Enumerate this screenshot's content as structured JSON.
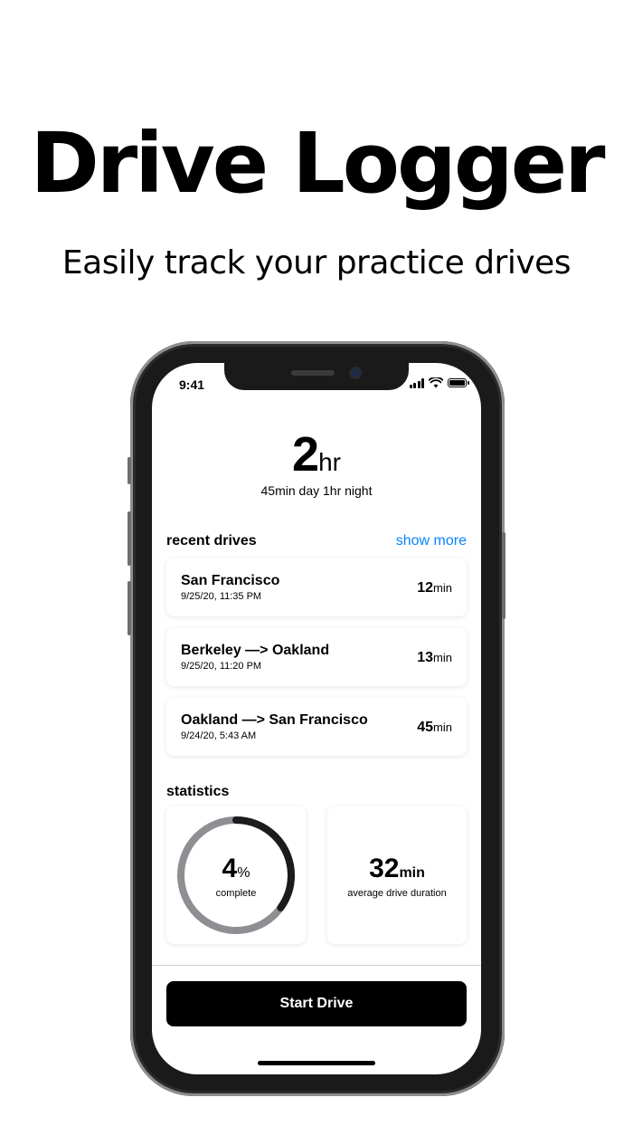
{
  "promo": {
    "headline": "Drive Logger",
    "subheadline": "Easily track your practice drives"
  },
  "status_bar": {
    "time": "9:41",
    "icons": [
      "cellular-signal-icon",
      "wifi-icon",
      "battery-icon"
    ]
  },
  "summary": {
    "total_value": "2",
    "total_unit": "hr",
    "breakdown": "45min day 1hr night"
  },
  "recent_drives": {
    "title": "recent drives",
    "show_more_label": "show more",
    "items": [
      {
        "route": "San Francisco",
        "date": "9/25/20, 11:35 PM",
        "duration_value": "12",
        "duration_unit": "min"
      },
      {
        "route": "Berkeley —> Oakland",
        "date": "9/25/20, 11:20 PM",
        "duration_value": "13",
        "duration_unit": "min"
      },
      {
        "route": "Oakland —> San Francisco",
        "date": "9/24/20, 5:43 AM",
        "duration_value": "45",
        "duration_unit": "min"
      }
    ]
  },
  "statistics": {
    "title": "statistics",
    "progress": {
      "value": "4",
      "unit": "%",
      "label": "complete",
      "ring_fraction": 0.35
    },
    "average": {
      "value": "32",
      "unit": "min",
      "label": "average drive duration"
    }
  },
  "actions": {
    "start_drive_label": "Start Drive"
  },
  "colors": {
    "accent": "#0a84ff",
    "ring_track": "#8e8e93",
    "ring_progress": "#1c1c1e",
    "button_bg": "#000000"
  }
}
